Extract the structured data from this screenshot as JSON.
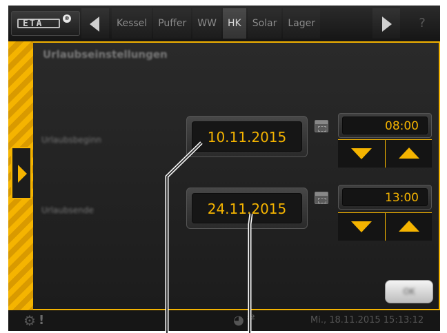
{
  "header": {
    "logo_text": "ETA",
    "logo_reg": "®",
    "tabs": [
      "Kessel",
      "Puffer",
      "WW",
      "HK",
      "Solar",
      "Lager"
    ],
    "active_tab": "HK",
    "help_label": "?"
  },
  "main": {
    "title": "Urlaubseinstellungen",
    "rows": [
      {
        "label": "Urlaubsbeginn",
        "date": "10.11.2015",
        "time": "08:00"
      },
      {
        "label": "Urlaubsende",
        "date": "24.11.2015",
        "time": "13:00"
      }
    ],
    "ok_label": "OK"
  },
  "status": {
    "datetime": "Mi., 18.11.2015 15:13:12",
    "warn_symbol": "!"
  },
  "icons": {
    "logo": "eta-logo",
    "left_nav": "arrow-left-icon",
    "right_nav": "arrow-right-icon",
    "side": "arrow-right-icon",
    "calendar": "calendar-icon",
    "down": "arrow-down-icon",
    "up": "arrow-up-icon",
    "gear": "gear-icon",
    "network": "network-icon"
  },
  "colors": {
    "accent": "#f5b400",
    "background": "#222222"
  }
}
